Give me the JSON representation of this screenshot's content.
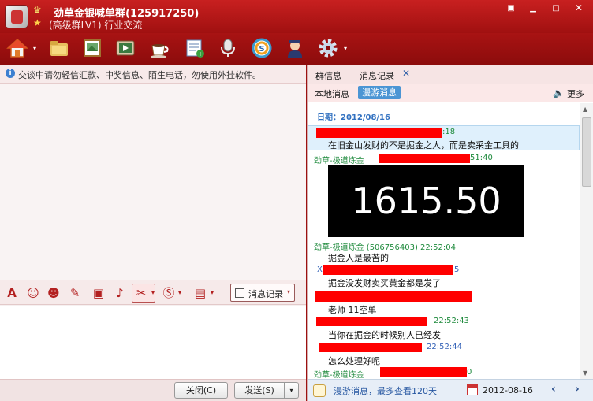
{
  "window": {
    "title": "劲草金银喊单群(125917250)",
    "subtitle": "(高级群LV1) 行业交流",
    "controls": {
      "menu": "▣",
      "minimize": "▁",
      "maximize": "□",
      "close": "✕"
    }
  },
  "toolbar": {
    "tools": [
      "home-icon",
      "folder-icon",
      "album-icon",
      "video-icon",
      "coffee-icon",
      "notice-icon",
      "microphone-icon",
      "soso-icon",
      "admin-icon",
      "gear-icon"
    ],
    "dropdown_glyph": "▾"
  },
  "left": {
    "notice_icon": "i",
    "notice_text": "交谈中请勿轻信汇款、中奖信息、陌生电话，勿使用外挂软件。",
    "format_bar": {
      "font_glyph": "A",
      "emoji_glyph": "☺",
      "shake_glyph": "☻",
      "edit_glyph": "✎",
      "image_glyph": "▣",
      "music_glyph": "♪",
      "scissors_glyph": "✂",
      "soso_glyph": "Ⓢ",
      "screen_glyph": "▤",
      "dropdown_glyph": "▾",
      "history_label": "消息记录"
    },
    "close_label": "关闭(C)",
    "send_label": "发送(S)"
  },
  "right": {
    "tabs": {
      "info": "群信息",
      "history": "消息记录",
      "close_glyph": "✕"
    },
    "subtabs": {
      "local": "本地消息",
      "roam": "漫游消息",
      "more": "更多"
    },
    "date_header": "日期：2012/08/16",
    "messages": [
      {
        "sender": ":18",
        "text": "在旧金山发财的不是掘金之人，而是卖采金工具的"
      },
      {
        "sender": "劲草-极道炼金",
        "time": "51:40"
      },
      {
        "image_value": "1615.50"
      },
      {
        "sender": "劲草-极道炼金 (506756403)  22:52:04",
        "text": "掘金人是最苦的"
      },
      {
        "sender": "X",
        "time": "5",
        "text": "掘金没发财卖买黄金都是发了"
      },
      {
        "text": "老师   11空单"
      },
      {
        "time": "22:52:43",
        "text": "当你在掘金的时候别人已经发"
      },
      {
        "time": "22:52:44",
        "text": "怎么处理好呢"
      },
      {
        "sender": "劲草-极道炼金",
        "time": "0"
      }
    ],
    "status": {
      "roam_text": "漫游消息，最多查看120天",
      "date": "2012-08-16",
      "prev": "‹",
      "next": "›"
    }
  }
}
